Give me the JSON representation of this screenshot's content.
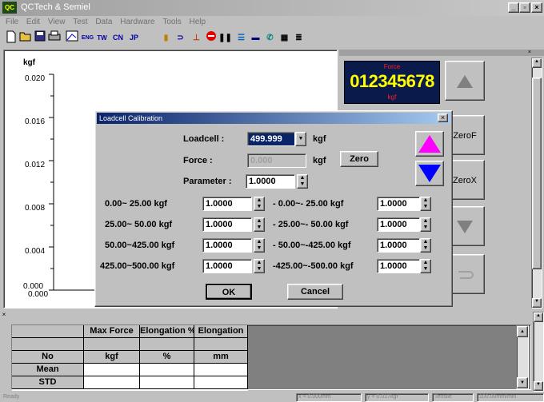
{
  "window": {
    "title": "QCTech & Semiel",
    "app_icon": "QC"
  },
  "menu": [
    "File",
    "Edit",
    "View",
    "Test",
    "Data",
    "Hardware",
    "Tools",
    "Help"
  ],
  "toolbar": {
    "icons": [
      "new-icon",
      "open-icon",
      "save-icon",
      "print-icon",
      "chart-icon",
      "english-icon",
      "tw-icon",
      "cn-icon",
      "jp-icon",
      "grip-icon",
      "return-icon",
      "down-arrow-icon",
      "stop-icon",
      "pause-icon",
      "list-icon",
      "card-icon",
      "settings-icon",
      "table-icon",
      "report-icon"
    ],
    "en_label": "ENG",
    "tw_label": "TW",
    "cn_label": "CN",
    "jp_label": "JP"
  },
  "chart": {
    "ylabel": "kgf",
    "yticks": [
      "0.020",
      "0.016",
      "0.012",
      "0.008",
      "0.004",
      "0.000"
    ],
    "xtick0": "0.000"
  },
  "display": {
    "title": "Force",
    "value": "012345678",
    "unit": "kgf"
  },
  "side_buttons": {
    "zerof": "ZeroF",
    "zerox": "ZeroX"
  },
  "dialog": {
    "title": "Loadcell Calibration",
    "loadcell_label": "Loadcell :",
    "loadcell_value": "499.999",
    "loadcell_unit": "kgf",
    "force_label": "Force :",
    "force_value": "0.000",
    "force_unit": "kgf",
    "zero_button": "Zero",
    "parameter_label": "Parameter :",
    "parameter_value": "1.0000",
    "rows": [
      {
        "left": "0.00~ 25.00 kgf",
        "lval": "1.0000",
        "right": "- 0.00~- 25.00 kgf",
        "rval": "1.0000"
      },
      {
        "left": "25.00~ 50.00 kgf",
        "lval": "1.0000",
        "right": "- 25.00~- 50.00 kgf",
        "rval": "1.0000"
      },
      {
        "left": "50.00~425.00 kgf",
        "lval": "1.0000",
        "right": "- 50.00~-425.00 kgf",
        "rval": "1.0000"
      },
      {
        "left": "425.00~500.00 kgf",
        "lval": "1.0000",
        "right": "-425.00~-500.00 kgf",
        "rval": "1.0000"
      }
    ],
    "ok": "OK",
    "cancel": "Cancel"
  },
  "grid": {
    "headers": [
      "Max Force",
      "Elongation %",
      "Elongation"
    ],
    "units_label": "No",
    "units": [
      "kgf",
      "%",
      "mm"
    ],
    "rows": [
      "Mean",
      "STD"
    ]
  },
  "status": {
    "left": "Ready",
    "s1": "x = 0.000mm",
    "s2": "y = 0.017kgf",
    "s3": "Tensile",
    "s4": "100.00mm/min"
  },
  "colors": {
    "display_bg": "#0a1a4a",
    "display_value": "#ffff00",
    "display_title": "#ff2020",
    "up_arrow": "#ff00ff",
    "down_arrow": "#0000ff",
    "dialog_title": "#0a246a"
  }
}
